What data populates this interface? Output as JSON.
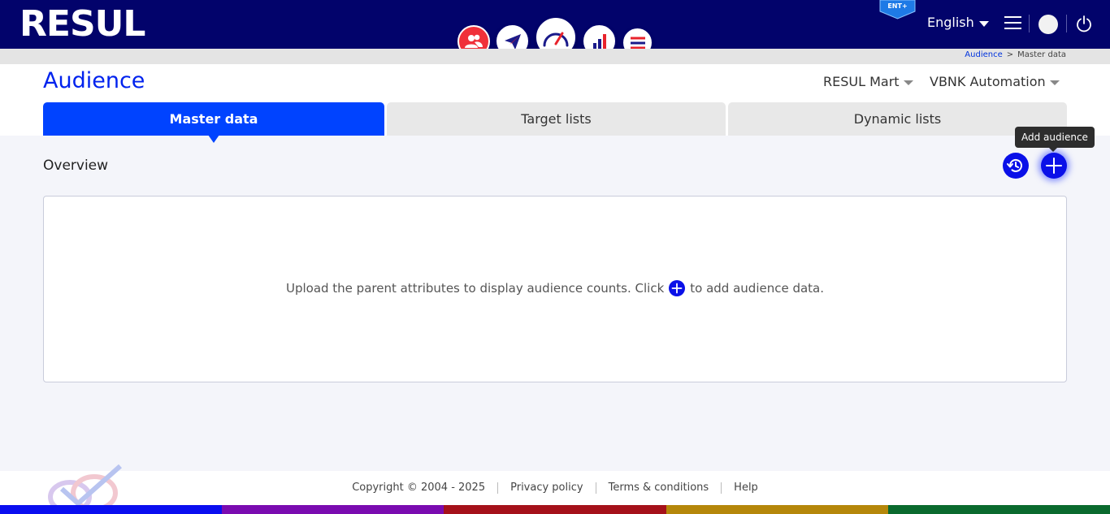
{
  "header": {
    "logo_text": "RESUL",
    "edition_badge": "ENT+",
    "language": "English",
    "modules": [
      {
        "name": "audience",
        "icon": "audience-icon"
      },
      {
        "name": "communication",
        "icon": "paper-plane-icon"
      },
      {
        "name": "dashboard",
        "icon": "gauge-icon"
      },
      {
        "name": "analytics",
        "icon": "bar-chart-icon"
      },
      {
        "name": "preferences",
        "icon": "sliders-icon"
      }
    ]
  },
  "breadcrumb": {
    "link": "Audience",
    "separator": ">",
    "current": "Master data"
  },
  "page": {
    "title": "Audience",
    "department": "RESUL Mart",
    "account": "VBNK Automation"
  },
  "tabs": [
    {
      "label": "Master data",
      "active": true
    },
    {
      "label": "Target lists",
      "active": false
    },
    {
      "label": "Dynamic lists",
      "active": false
    }
  ],
  "section": {
    "title": "Overview",
    "tooltip": "Add audience"
  },
  "empty_state": {
    "before": "Upload the parent attributes to display audience counts. Click",
    "after": "to add audience data."
  },
  "footer": {
    "copyright": "Copyright © 2004 - 2025",
    "privacy": "Privacy policy",
    "terms": "Terms & conditions",
    "help": "Help"
  },
  "colors": {
    "brand_navy": "#02036b",
    "accent_blue": "#0043ff",
    "title_blue": "#0022ee",
    "footer_bar": [
      "#0a0ef0",
      "#7a0bb0",
      "#a5111a",
      "#b5870a",
      "#0a6a2e"
    ]
  }
}
